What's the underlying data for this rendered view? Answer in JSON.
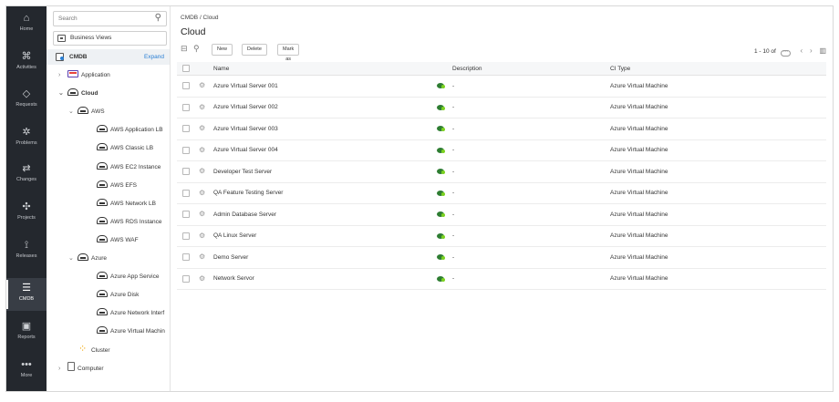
{
  "rail": {
    "items": [
      {
        "label": "Home",
        "icon": "home-icon",
        "glyph": "⌂"
      },
      {
        "label": "Activities",
        "icon": "activities-icon",
        "glyph": "⌘"
      },
      {
        "label": "Requests",
        "icon": "requests-icon",
        "glyph": "◇"
      },
      {
        "label": "Problems",
        "icon": "problems-icon",
        "glyph": "✲"
      },
      {
        "label": "Changes",
        "icon": "changes-icon",
        "glyph": "⇄"
      },
      {
        "label": "Projects",
        "icon": "projects-icon",
        "glyph": "✣"
      },
      {
        "label": "Releases",
        "icon": "releases-icon",
        "glyph": "⟟"
      },
      {
        "label": "CMDB",
        "icon": "database-icon",
        "glyph": "☰"
      },
      {
        "label": "Reports",
        "icon": "reports-icon",
        "glyph": "▣"
      },
      {
        "label": "More",
        "icon": "more-icon",
        "glyph": "•••"
      }
    ],
    "active": "CMDB"
  },
  "tree": {
    "search_placeholder": "Search",
    "business_views": "Business Views",
    "cmdb_label": "CMDB",
    "expand_label": "Expand",
    "nodes": [
      {
        "label": "Application",
        "chevron": "›",
        "icon": "app"
      },
      {
        "label": "Cloud",
        "chevron": "⌄",
        "icon": "cloud"
      },
      {
        "label": "AWS",
        "chevron": "⌄",
        "icon": "cloud"
      },
      {
        "label": "AWS Application LB",
        "chevron": "",
        "icon": "cloud"
      },
      {
        "label": "AWS Classic LB",
        "chevron": "",
        "icon": "cloud"
      },
      {
        "label": "AWS EC2 Instance",
        "chevron": "",
        "icon": "cloud"
      },
      {
        "label": "AWS EFS",
        "chevron": "",
        "icon": "cloud"
      },
      {
        "label": "AWS Network LB",
        "chevron": "",
        "icon": "cloud"
      },
      {
        "label": "AWS RDS Instance",
        "chevron": "",
        "icon": "cloud"
      },
      {
        "label": "AWS WAF",
        "chevron": "",
        "icon": "cloud"
      },
      {
        "label": "Azure",
        "chevron": "⌄",
        "icon": "cloud"
      },
      {
        "label": "Azure App Service",
        "chevron": "",
        "icon": "cloud"
      },
      {
        "label": "Azure Disk",
        "chevron": "",
        "icon": "cloud"
      },
      {
        "label": "Azure Network Interf",
        "chevron": "",
        "icon": "cloud"
      },
      {
        "label": "Azure Virtual Machin",
        "chevron": "",
        "icon": "cloud"
      },
      {
        "label": "Cluster",
        "chevron": "",
        "icon": "cluster"
      },
      {
        "label": "Computer",
        "chevron": "›",
        "icon": "computer"
      }
    ]
  },
  "main": {
    "breadcrumb": "CMDB / Cloud",
    "title": "Cloud",
    "toolbar": {
      "new_label": "New",
      "delete_label": "Delete",
      "mark_label": "Mark as CIs"
    },
    "pager": {
      "range": "1 - 10 of",
      "more": "···"
    },
    "columns": {
      "name": "Name",
      "description": "Description",
      "ci_type": "CI Type"
    },
    "rows": [
      {
        "name": "Azure Virtual Server 001",
        "description": "-",
        "ci_type": "Azure Virtual Machine"
      },
      {
        "name": "Azure Virtual Server 002",
        "description": "-",
        "ci_type": "Azure Virtual Machine"
      },
      {
        "name": "Azure Virtual Server 003",
        "description": "-",
        "ci_type": "Azure Virtual Machine"
      },
      {
        "name": "Azure Virtual Server 004",
        "description": "-",
        "ci_type": "Azure Virtual Machine"
      },
      {
        "name": "Developer Test Server",
        "description": "-",
        "ci_type": "Azure Virtual Machine"
      },
      {
        "name": "QA Feature Testing Server",
        "description": "-",
        "ci_type": "Azure Virtual Machine"
      },
      {
        "name": "Admin Database Server",
        "description": "-",
        "ci_type": "Azure Virtual Machine"
      },
      {
        "name": "QA Linux Server",
        "description": "-",
        "ci_type": "Azure Virtual Machine"
      },
      {
        "name": "Demo Server",
        "description": "-",
        "ci_type": "Azure Virtual Machine"
      },
      {
        "name": "Network Servor",
        "description": "-",
        "ci_type": "Azure Virtual Machine"
      }
    ]
  }
}
